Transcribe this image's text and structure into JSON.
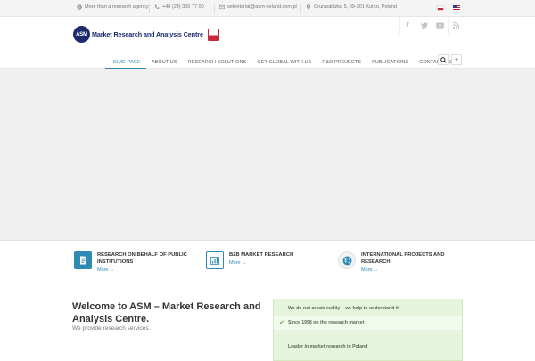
{
  "topbar": {
    "tagline": "More than a research agency",
    "phone": "+48 (24) 355 77 00",
    "email": "sekretariat@asm-poland.com.pl",
    "address": "Grunwaldzka 5, 99-301 Kutno, Poland",
    "languages": [
      "Polish",
      "English"
    ]
  },
  "logo": {
    "badge": "ASM",
    "text": "Market Research and Analysis Centre"
  },
  "social": [
    "f",
    "t",
    "▶",
    "rss"
  ],
  "nav": {
    "items": [
      "HOME PAGE",
      "ABOUT US",
      "RESEARCH SOLUTIONS",
      "GET GLOBAL WITH US",
      "R&D PROJECTS",
      "PUBLICATIONS",
      "CONTACT US"
    ],
    "search_symbol": "⌕",
    "plus_symbol": "+"
  },
  "features": [
    {
      "title": "RESEARCH ON BEHALF OF PUBLIC INSTITUTIONS",
      "more": "More →",
      "icon": "document-icon"
    },
    {
      "title": "B2B MARKET RESEARCH",
      "more": "More →",
      "icon": "chart-icon"
    },
    {
      "title": "INTERNATIONAL PROJECTS AND RESEARCH",
      "more": "More →",
      "icon": "globe-icon"
    }
  ],
  "welcome": {
    "title": "Welcome to ASM – Market Research and Analysis Centre.",
    "subtitle": "We provide research services."
  },
  "highlights": [
    "We do not create reality – we help to understand it",
    "Since 1998 on the research market",
    "Leader in market research in Poland"
  ],
  "colors": {
    "accent": "#2e8ab3",
    "brand": "#1d2a6e",
    "highlight_bg": "#e6f4dd"
  }
}
